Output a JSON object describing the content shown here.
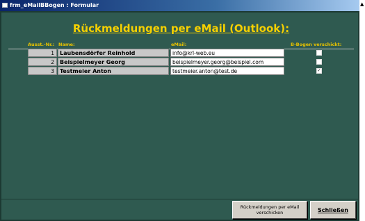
{
  "window": {
    "title": "frm_eMailBBogen : Formular"
  },
  "form": {
    "heading": "Rückmeldungen per eMail (Outlook):",
    "columns": {
      "number": "Ausst.-Nr.:",
      "name": "Name:",
      "email": "eMail:",
      "sent": "B-Bogen verschickt:"
    },
    "rows": [
      {
        "number": "1",
        "name": "Laubensdörfer Reinhold",
        "email": "info@krl-web.eu",
        "sent": false
      },
      {
        "number": "2",
        "name": "Beispielmeyer Georg",
        "email": "beispielmeyer.georg@beispiel.com",
        "sent": false
      },
      {
        "number": "3",
        "name": "Testmeier Anton",
        "email": "testmeier.anton@test.de",
        "sent": true
      }
    ]
  },
  "buttons": {
    "send_label": "Rückmeldungen per eMail verschicken",
    "close_label": "Schließen"
  },
  "colors": {
    "form_background": "#2f5a50",
    "heading": "#f5d000",
    "column_headers": "#e8c200",
    "title_bar": "#0a246a"
  }
}
